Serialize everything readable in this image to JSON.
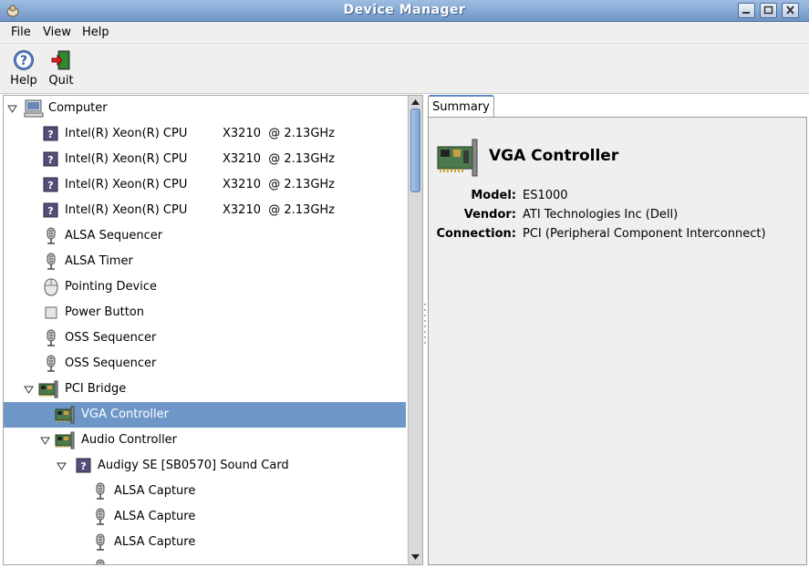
{
  "window": {
    "title": "Device Manager"
  },
  "menu": {
    "file": "File",
    "view": "View",
    "help": "Help"
  },
  "toolbar": {
    "help_label": "Help",
    "quit_label": "Quit"
  },
  "tree": {
    "root": "Computer",
    "items": [
      {
        "name": "Intel(R) Xeon(R) CPU",
        "detail": "X3210  @ 2.13GHz"
      },
      {
        "name": "Intel(R) Xeon(R) CPU",
        "detail": "X3210  @ 2.13GHz"
      },
      {
        "name": "Intel(R) Xeon(R) CPU",
        "detail": "X3210  @ 2.13GHz"
      },
      {
        "name": "Intel(R) Xeon(R) CPU",
        "detail": "X3210  @ 2.13GHz"
      },
      {
        "name": "ALSA Sequencer"
      },
      {
        "name": "ALSA Timer"
      },
      {
        "name": "Pointing Device"
      },
      {
        "name": "Power Button"
      },
      {
        "name": "OSS Sequencer"
      },
      {
        "name": "OSS Sequencer"
      },
      {
        "name": "PCI Bridge"
      },
      {
        "name": "VGA Controller"
      },
      {
        "name": "Audio Controller"
      },
      {
        "name": "Audigy SE [SB0570] Sound Card"
      },
      {
        "name": "ALSA Capture"
      },
      {
        "name": "ALSA Capture"
      },
      {
        "name": "ALSA Capture"
      }
    ]
  },
  "details": {
    "tab": "Summary",
    "title": "VGA Controller",
    "model_label": "Model:",
    "model": "ES1000",
    "vendor_label": "Vendor:",
    "vendor": "ATI Technologies Inc (Dell)",
    "connection_label": "Connection:",
    "connection": "PCI (Peripheral Component Interconnect)"
  },
  "colors": {
    "selection": "#6e97c8",
    "titlebar": "#7f9fcf"
  }
}
